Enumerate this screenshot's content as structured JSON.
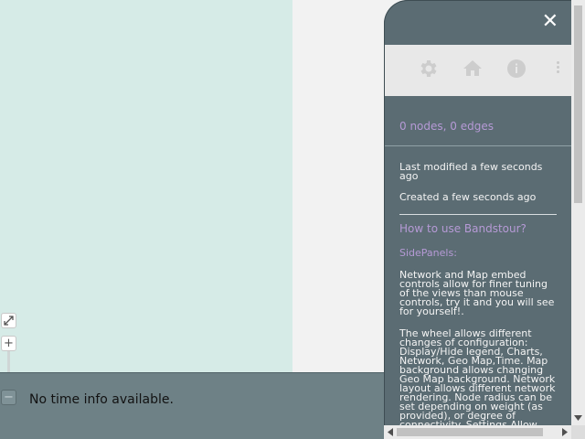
{
  "map": {
    "expand_icon": "expand-icon",
    "zoom_in_label": "+",
    "zoom_out_label": "−"
  },
  "timebar": {
    "message": "No time info available."
  },
  "sidepanel": {
    "close_label": "✕",
    "toolbar": {
      "icons": [
        "gear-icon",
        "home-icon",
        "info-icon",
        "more-vert-icon"
      ]
    },
    "counts": "0 nodes, 0 edges",
    "last_modified": "Last modified a few seconds ago",
    "created": "Created a few seconds ago",
    "how_to_link": "How to use Bandstour?",
    "sidepanels_heading": "SidePanels:",
    "paragraph1": "Network and Map embed controls allow for finer tuning of the views than mouse controls, try it and you will see for yourself!.",
    "paragraph2": "The wheel allows different changes of configuration: Display/Hide legend, Charts, Network, Geo Map,Time. Map background allows changing Geo Map background. Network layout allows different network rendering. Node radius can be set depending on weight (as provided), or degree of connectivity. Settings Allow"
  },
  "colors": {
    "map_bg": "#d6ebe7",
    "panel_bg": "#5b6c73",
    "accent_text": "#b69ad6",
    "timebar_bg": "#6e8186",
    "toolbar_bg": "#e8e8e8"
  }
}
